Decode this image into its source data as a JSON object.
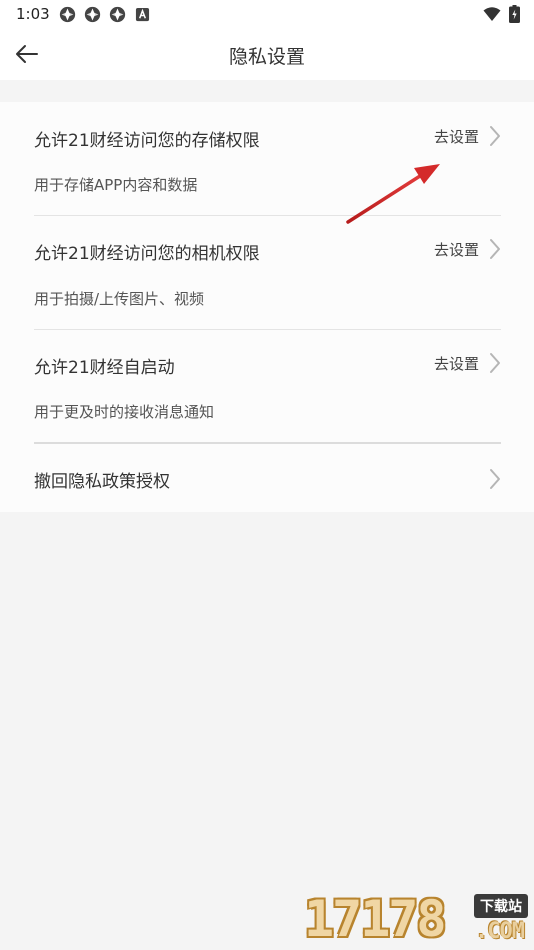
{
  "status_bar": {
    "time": "1:03",
    "left_icons": [
      "notification-icon",
      "notification-icon",
      "notification-icon",
      "a-badge-icon"
    ],
    "right_icons": [
      "wifi-icon",
      "battery-charging-icon"
    ]
  },
  "header": {
    "title": "隐私设置",
    "back_icon": "arrow-left-icon"
  },
  "settings": {
    "items": [
      {
        "title": "允许21财经访问您的存储权限",
        "description": "用于存储APP内容和数据",
        "action_label": "去设置"
      },
      {
        "title": "允许21财经访问您的相机权限",
        "description": "用于拍摄/上传图片、视频",
        "action_label": "去设置"
      },
      {
        "title": "允许21财经自启动",
        "description": "用于更及时的接收消息通知",
        "action_label": "去设置"
      },
      {
        "title": "撤回隐私政策授权"
      }
    ]
  },
  "watermark": {
    "digits": "17178",
    "tag": "下载站",
    "domain": ".COM"
  },
  "colors": {
    "page_background": "#f4f4f4",
    "card_background": "#fcfcfc",
    "annotation_arrow": "#d42a2a"
  }
}
